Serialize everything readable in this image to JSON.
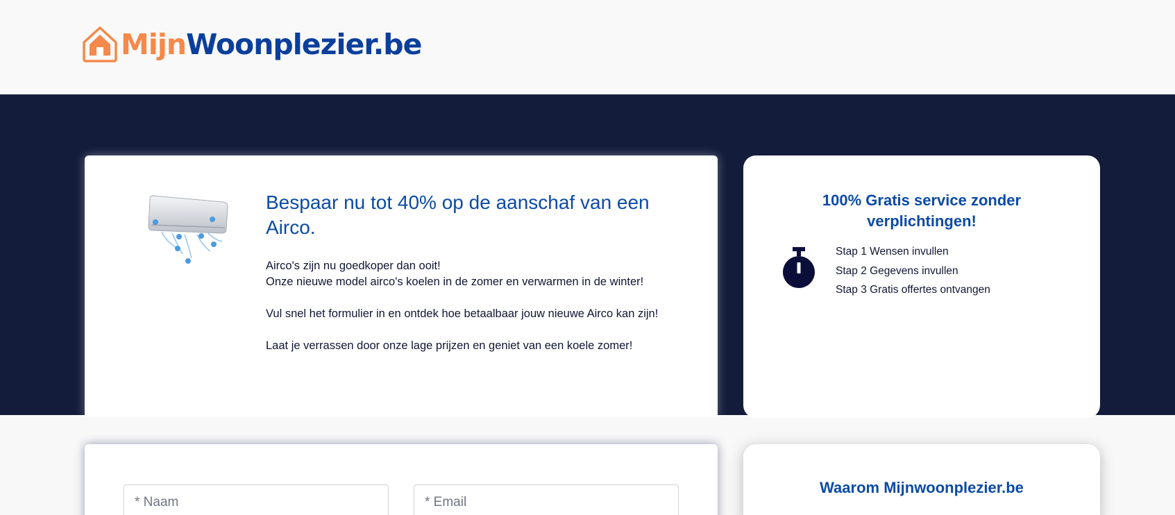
{
  "header": {
    "logo_part1": "Mijn",
    "logo_part2": "Woonplezier.be",
    "logo_icon": "house-icon"
  },
  "colors": {
    "header_bg": "#f9f9f9",
    "hero_bg": "#131d3b",
    "brand_orange": "#f5894a",
    "brand_blue": "#0b3f9c",
    "heading_blue": "#0b4aa6",
    "text_dark": "#111633"
  },
  "promo": {
    "image": "air-conditioner-icon",
    "headline": "Bespaar nu tot 40% op de aanschaf van een Airco.",
    "line1": "Airco's zijn nu goedkoper dan ooit!",
    "line2": "Onze nieuwe model airco's koelen in de zomer en verwarmen in de winter!",
    "para2": "Vul snel het formulier in en ontdek hoe betaalbaar jouw nieuwe Airco kan zijn!",
    "para3": "Laat je verrassen door onze lage prijzen en geniet van een koele zomer!"
  },
  "service": {
    "title": "100% Gratis service zonder verplichtingen!",
    "icon": "stopwatch-icon",
    "steps": [
      "Stap 1 Wensen invullen",
      "Stap 2 Gegevens invullen",
      "Stap 3 Gratis offertes ontvangen"
    ]
  },
  "form": {
    "name_placeholder": "* Naam",
    "email_placeholder": "* Email"
  },
  "why": {
    "title": "Waarom Mijnwoonplezier.be"
  }
}
